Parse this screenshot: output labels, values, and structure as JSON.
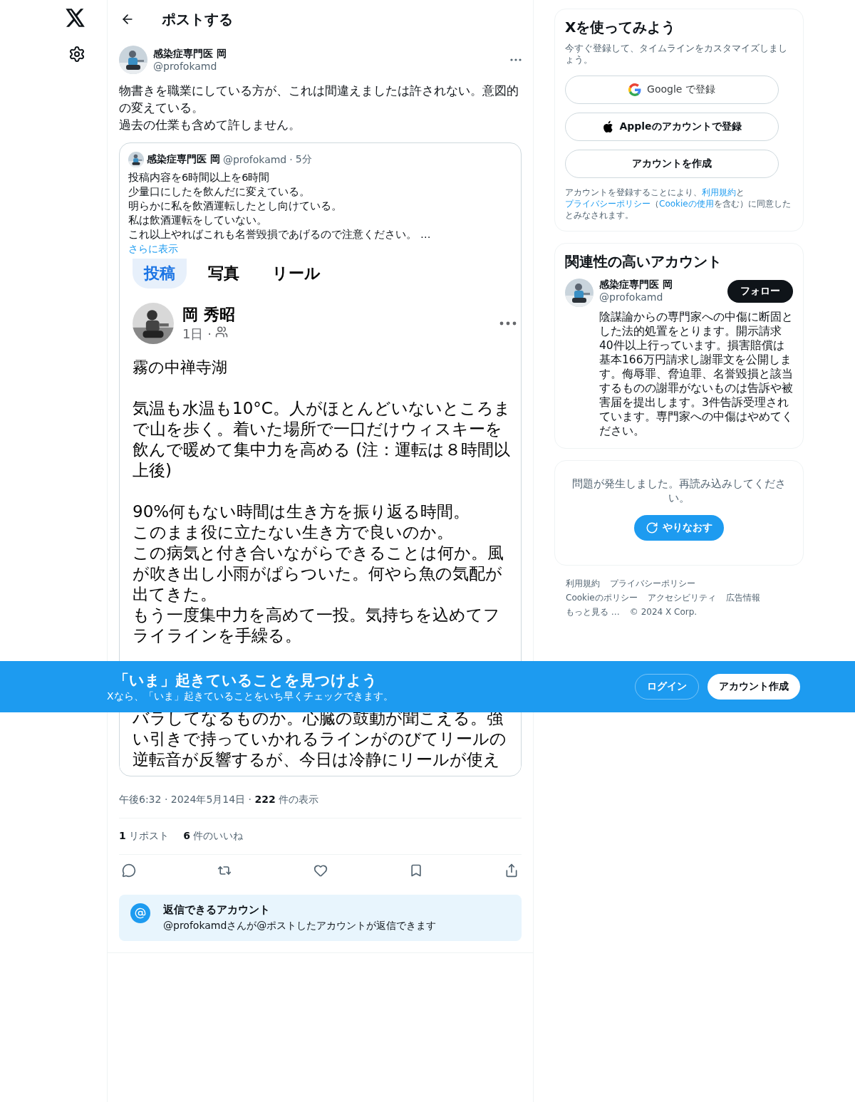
{
  "header": {
    "title": "ポストする"
  },
  "post": {
    "author": {
      "name": "感染症専門医 岡",
      "handle": "@profokamd"
    },
    "text": [
      "物書きを職業にしている方が、これは間違えましたは許されない。意図的の変えている。",
      "過去の仕業も含めて許しません。"
    ],
    "quote": {
      "name": "感染症専門医 岡",
      "handle": "@profokamd",
      "separator": "·",
      "time": "5分",
      "text": [
        "投稿内容を6時間以上を6時間",
        "少量口にしたを飲んだに変えている。",
        "明らかに私を飲酒運転したとし向けている。",
        "私は飲酒運転をしていない。",
        "これ以上やればこれも名誉毀損であげるので注意ください。"
      ],
      "ellipsis": "…",
      "show_more": "さらに表示",
      "image": {
        "tabs": [
          {
            "label": "投稿",
            "selected": true
          },
          {
            "label": "写真",
            "selected": false
          },
          {
            "label": "リール",
            "selected": false
          }
        ],
        "name": "岡 秀昭",
        "time": "1日 ·",
        "title": "霧の中禅寺湖",
        "paragraphs": [
          [
            "気温も水温も10°C。人がほとんどいないところまで山を歩く。着いた場所で一口だけウィスキーを飲んで暖めて集中力を高める (注：運転は８時間以上後)"
          ],
          [
            "90%何もない時間は生き方を振り返る時間。",
            "このまま役に立たない生き方で良いのか。",
            "この病気と付き合いながらできることは何か。風が吹き出し小雨がぱらついた。何やら魚の気配が出てきた。",
            "もう一度集中力を高めて一投。気持ちを込めてフライラインを手繰る。"
          ]
        ],
        "continued": "バラしてなるものか。心臓の鼓動が聞こえる。強い引きで持っていかれるラインがのびてリールの逆転音が反響するが、今日は冷静にリールが使え"
      }
    },
    "meta": {
      "time": "午後6:32 · 2024年5月14日 ·",
      "views": "222",
      "views_label": "件の表示"
    },
    "stats": [
      {
        "count": "1",
        "label": "リポスト"
      },
      {
        "count": "6",
        "label": "件のいいね"
      }
    ],
    "reply_notice": {
      "title": "返信できるアカウント",
      "text": "@profokamdさんが@ポストしたアカウントが返信できます"
    }
  },
  "signup": {
    "title": "Xを使ってみよう",
    "subtitle": "今すぐ登録して、タイムラインをカスタマイズしましょう。",
    "buttons": [
      {
        "kind": "google",
        "label": "Google で登録"
      },
      {
        "kind": "apple",
        "label": "Appleのアカウントで登録"
      },
      {
        "kind": "create",
        "label": "アカウントを作成"
      }
    ],
    "terms": [
      {
        "text": "アカウントを登録することにより、",
        "link": false
      },
      {
        "text": "利用規約",
        "link": true
      },
      {
        "text": "と",
        "link": false
      },
      {
        "text": "プライバシーポリシー",
        "link": true
      },
      {
        "text": "（",
        "link": false
      },
      {
        "text": "Cookieの使用",
        "link": true
      },
      {
        "text": "を含む）に同意したとみなされます。",
        "link": false
      }
    ]
  },
  "related": {
    "title": "関連性の高いアカウント",
    "name": "感染症専門医 岡",
    "handle": "@profokamd",
    "follow": "フォロー",
    "bio": "陰謀論からの専門家への中傷に断固とした法的処置をとります。開示請求40件以上行っています。損害賠償は基本166万円請求し謝罪文を公開します。侮辱罪、脅迫罪、名誉毀損と該当するものの謝罪がないものは告訴や被害届を提出します。3件告訴受理されています。専門家への中傷はやめてください。"
  },
  "error": {
    "text": "問題が発生しました。再読み込みしてください。",
    "retry": "やりなおす"
  },
  "footer": [
    [
      "利用規約",
      "プライバシーポリシー"
    ],
    [
      "Cookieのポリシー",
      "アクセシビリティ",
      "広告情報"
    ],
    [
      "もっと見る …",
      "© 2024 X Corp."
    ]
  ],
  "banner": {
    "title": "「いま」起きていることを見つけよう",
    "subtitle": "Xなら、「いま」起きていることをいち早くチェックできます。",
    "login": "ログイン",
    "signup": "アカウント作成"
  }
}
